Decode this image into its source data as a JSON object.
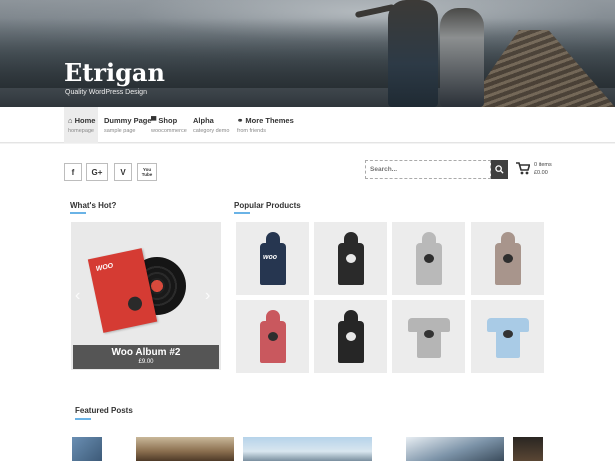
{
  "header": {
    "site_title": "Etrigan",
    "tagline": "Quality WordPress Design"
  },
  "nav": {
    "items": [
      {
        "label": "Home",
        "sub": "homepage",
        "icon": "home-icon",
        "active": true
      },
      {
        "label": "Dummy Page",
        "sub": "sample page",
        "icon": "",
        "active": false
      },
      {
        "label": "Shop",
        "sub": "woocommerce",
        "icon": "cart-icon",
        "active": false
      },
      {
        "label": "Alpha",
        "sub": "category demo",
        "icon": "",
        "active": false
      },
      {
        "label": "More Themes",
        "sub": "from friends",
        "icon": "link-icon",
        "active": false
      }
    ]
  },
  "social": {
    "facebook": "f",
    "google_plus": "G+",
    "vine": "V",
    "youtube": "You Tube"
  },
  "search": {
    "placeholder": "Search..."
  },
  "cart": {
    "items": "0 items",
    "price": "£0.00"
  },
  "whats_hot": {
    "title": "What's Hot?",
    "slide": {
      "title": "Woo Album #2",
      "price": "£9.00",
      "sleeve_logo": "WOO"
    }
  },
  "popular_products": {
    "title": "Popular Products",
    "items": [
      {
        "kind": "hoodie",
        "color": "#263650",
        "emblem": "woo"
      },
      {
        "kind": "hoodie",
        "color": "#2a2a2a",
        "emblem": "skull"
      },
      {
        "kind": "hoodie",
        "color": "#b9b9b9",
        "emblem": "skull"
      },
      {
        "kind": "hoodie",
        "color": "#a8958c",
        "emblem": "skull"
      },
      {
        "kind": "hoodie",
        "color": "#c9585e",
        "emblem": "skull"
      },
      {
        "kind": "hoodie",
        "color": "#262626",
        "emblem": "skull"
      },
      {
        "kind": "tee",
        "color": "#b5b5b5",
        "emblem": "skull"
      },
      {
        "kind": "tee",
        "color": "#a9cbe6",
        "emblem": "skull"
      }
    ]
  },
  "featured_posts": {
    "title": "Featured Posts"
  },
  "colors": {
    "accent": "#6ab3e6",
    "search_button": "#3f3f3f",
    "caption_bg": "#555555"
  }
}
